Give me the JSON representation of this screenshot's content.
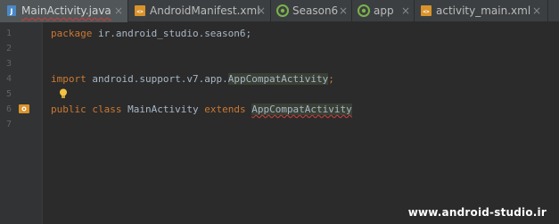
{
  "tabs": [
    {
      "label": "MainActivity.java",
      "icon": "java-class-icon",
      "active": true
    },
    {
      "label": "AndroidManifest.xml",
      "icon": "xml-file-icon",
      "active": false
    },
    {
      "label": "Season6",
      "icon": "android-module-icon",
      "active": false
    },
    {
      "label": "app",
      "icon": "android-module-icon",
      "active": false
    },
    {
      "label": "activity_main.xml",
      "icon": "xml-file-icon",
      "active": false
    }
  ],
  "close_glyph": "×",
  "line_numbers": [
    "1",
    "2",
    "3",
    "4",
    "5",
    "6",
    "7"
  ],
  "code": {
    "line1": {
      "keyword": "package",
      "rest": " ir.android_studio.season6;"
    },
    "line4": {
      "keyword": "import",
      "mid": " android.support.v7.app.",
      "highlight": "AppCompatActivity",
      "end": ";"
    },
    "line6": {
      "kw1": "public",
      "kw2": "class",
      "name": " MainActivity ",
      "kw3": "extends",
      "parent": "AppCompatActivity"
    }
  },
  "gutter_icons": [
    "run-activity-icon"
  ],
  "editor_icons": [
    "lightbulb-icon"
  ],
  "watermark": "www.android-studio.ir",
  "colors": {
    "background": "#2b2b2b",
    "tabbar": "#3c3f41",
    "keyword": "#cc7832",
    "text": "#a9b7c6",
    "error_underline": "#bc3f3c"
  }
}
